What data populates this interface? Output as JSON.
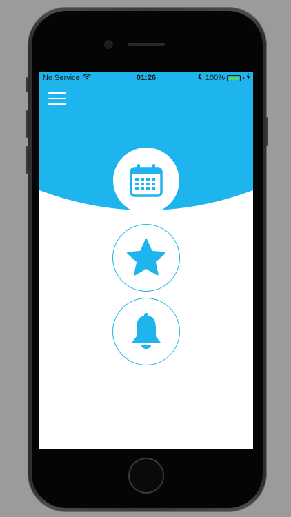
{
  "status_bar": {
    "carrier": "No Service",
    "time": "01:26",
    "battery_percent": "100%",
    "battery_level": 1.0
  },
  "colors": {
    "accent": "#1eb4ee",
    "background": "#ffffff",
    "frame_background": "#9b9b9b",
    "battery_green": "#4cd964"
  },
  "icons": {
    "menu": "hamburger-menu-icon",
    "calendar": "calendar-icon",
    "favorites": "star-icon",
    "notifications": "bell-icon"
  }
}
